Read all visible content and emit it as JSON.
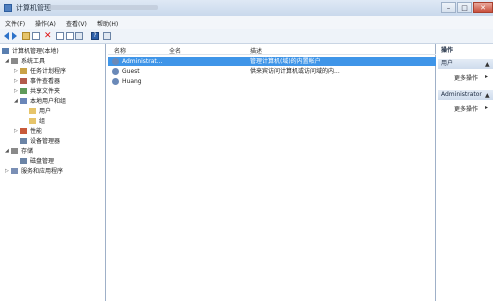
{
  "window": {
    "title": "计算机管理"
  },
  "menu": [
    "文件(F)",
    "操作(A)",
    "查看(V)",
    "帮助(H)"
  ],
  "tree": [
    {
      "label": "计算机管理(本地)",
      "icon": "computer-icon",
      "level": 0,
      "expander": ""
    },
    {
      "label": "系统工具",
      "icon": "tools-icon",
      "level": 1,
      "expander": "◢"
    },
    {
      "label": "任务计划程序",
      "icon": "clock-icon",
      "level": 2,
      "expander": "▷"
    },
    {
      "label": "事件查看器",
      "icon": "event-icon",
      "level": 2,
      "expander": "▷"
    },
    {
      "label": "共享文件夹",
      "icon": "share-icon",
      "level": 2,
      "expander": "▷"
    },
    {
      "label": "本地用户和组",
      "icon": "users-icon",
      "level": 2,
      "expander": "◢"
    },
    {
      "label": "用户",
      "icon": "folder-icon",
      "level": 3,
      "expander": ""
    },
    {
      "label": "组",
      "icon": "folder-icon",
      "level": 3,
      "expander": ""
    },
    {
      "label": "性能",
      "icon": "performance-icon",
      "level": 2,
      "expander": "▷"
    },
    {
      "label": "设备管理器",
      "icon": "device-icon",
      "level": 2,
      "expander": ""
    },
    {
      "label": "存储",
      "icon": "storage-icon",
      "level": 1,
      "expander": "◢"
    },
    {
      "label": "磁盘管理",
      "icon": "disk-icon",
      "level": 2,
      "expander": ""
    },
    {
      "label": "服务和应用程序",
      "icon": "services-icon",
      "level": 1,
      "expander": "▷"
    }
  ],
  "columns": {
    "name": "名称",
    "fullname": "全名",
    "description": "描述"
  },
  "users": [
    {
      "name": "Administrat...",
      "fullname": "",
      "description": "管理计算机(域)的内置帐户",
      "selected": true
    },
    {
      "name": "Guest",
      "fullname": "",
      "description": "供来宾访问计算机或访问域的内...",
      "selected": false
    },
    {
      "name": "Huang",
      "fullname": "",
      "description": "",
      "selected": false
    }
  ],
  "actions": {
    "header": "操作",
    "sections": [
      {
        "title": "用户",
        "items": [
          "更多操作"
        ]
      },
      {
        "title": "Administrator",
        "items": [
          "更多操作"
        ]
      }
    ]
  },
  "colors": {
    "selection": "#3f95e8",
    "accent": "#2d72c9"
  }
}
